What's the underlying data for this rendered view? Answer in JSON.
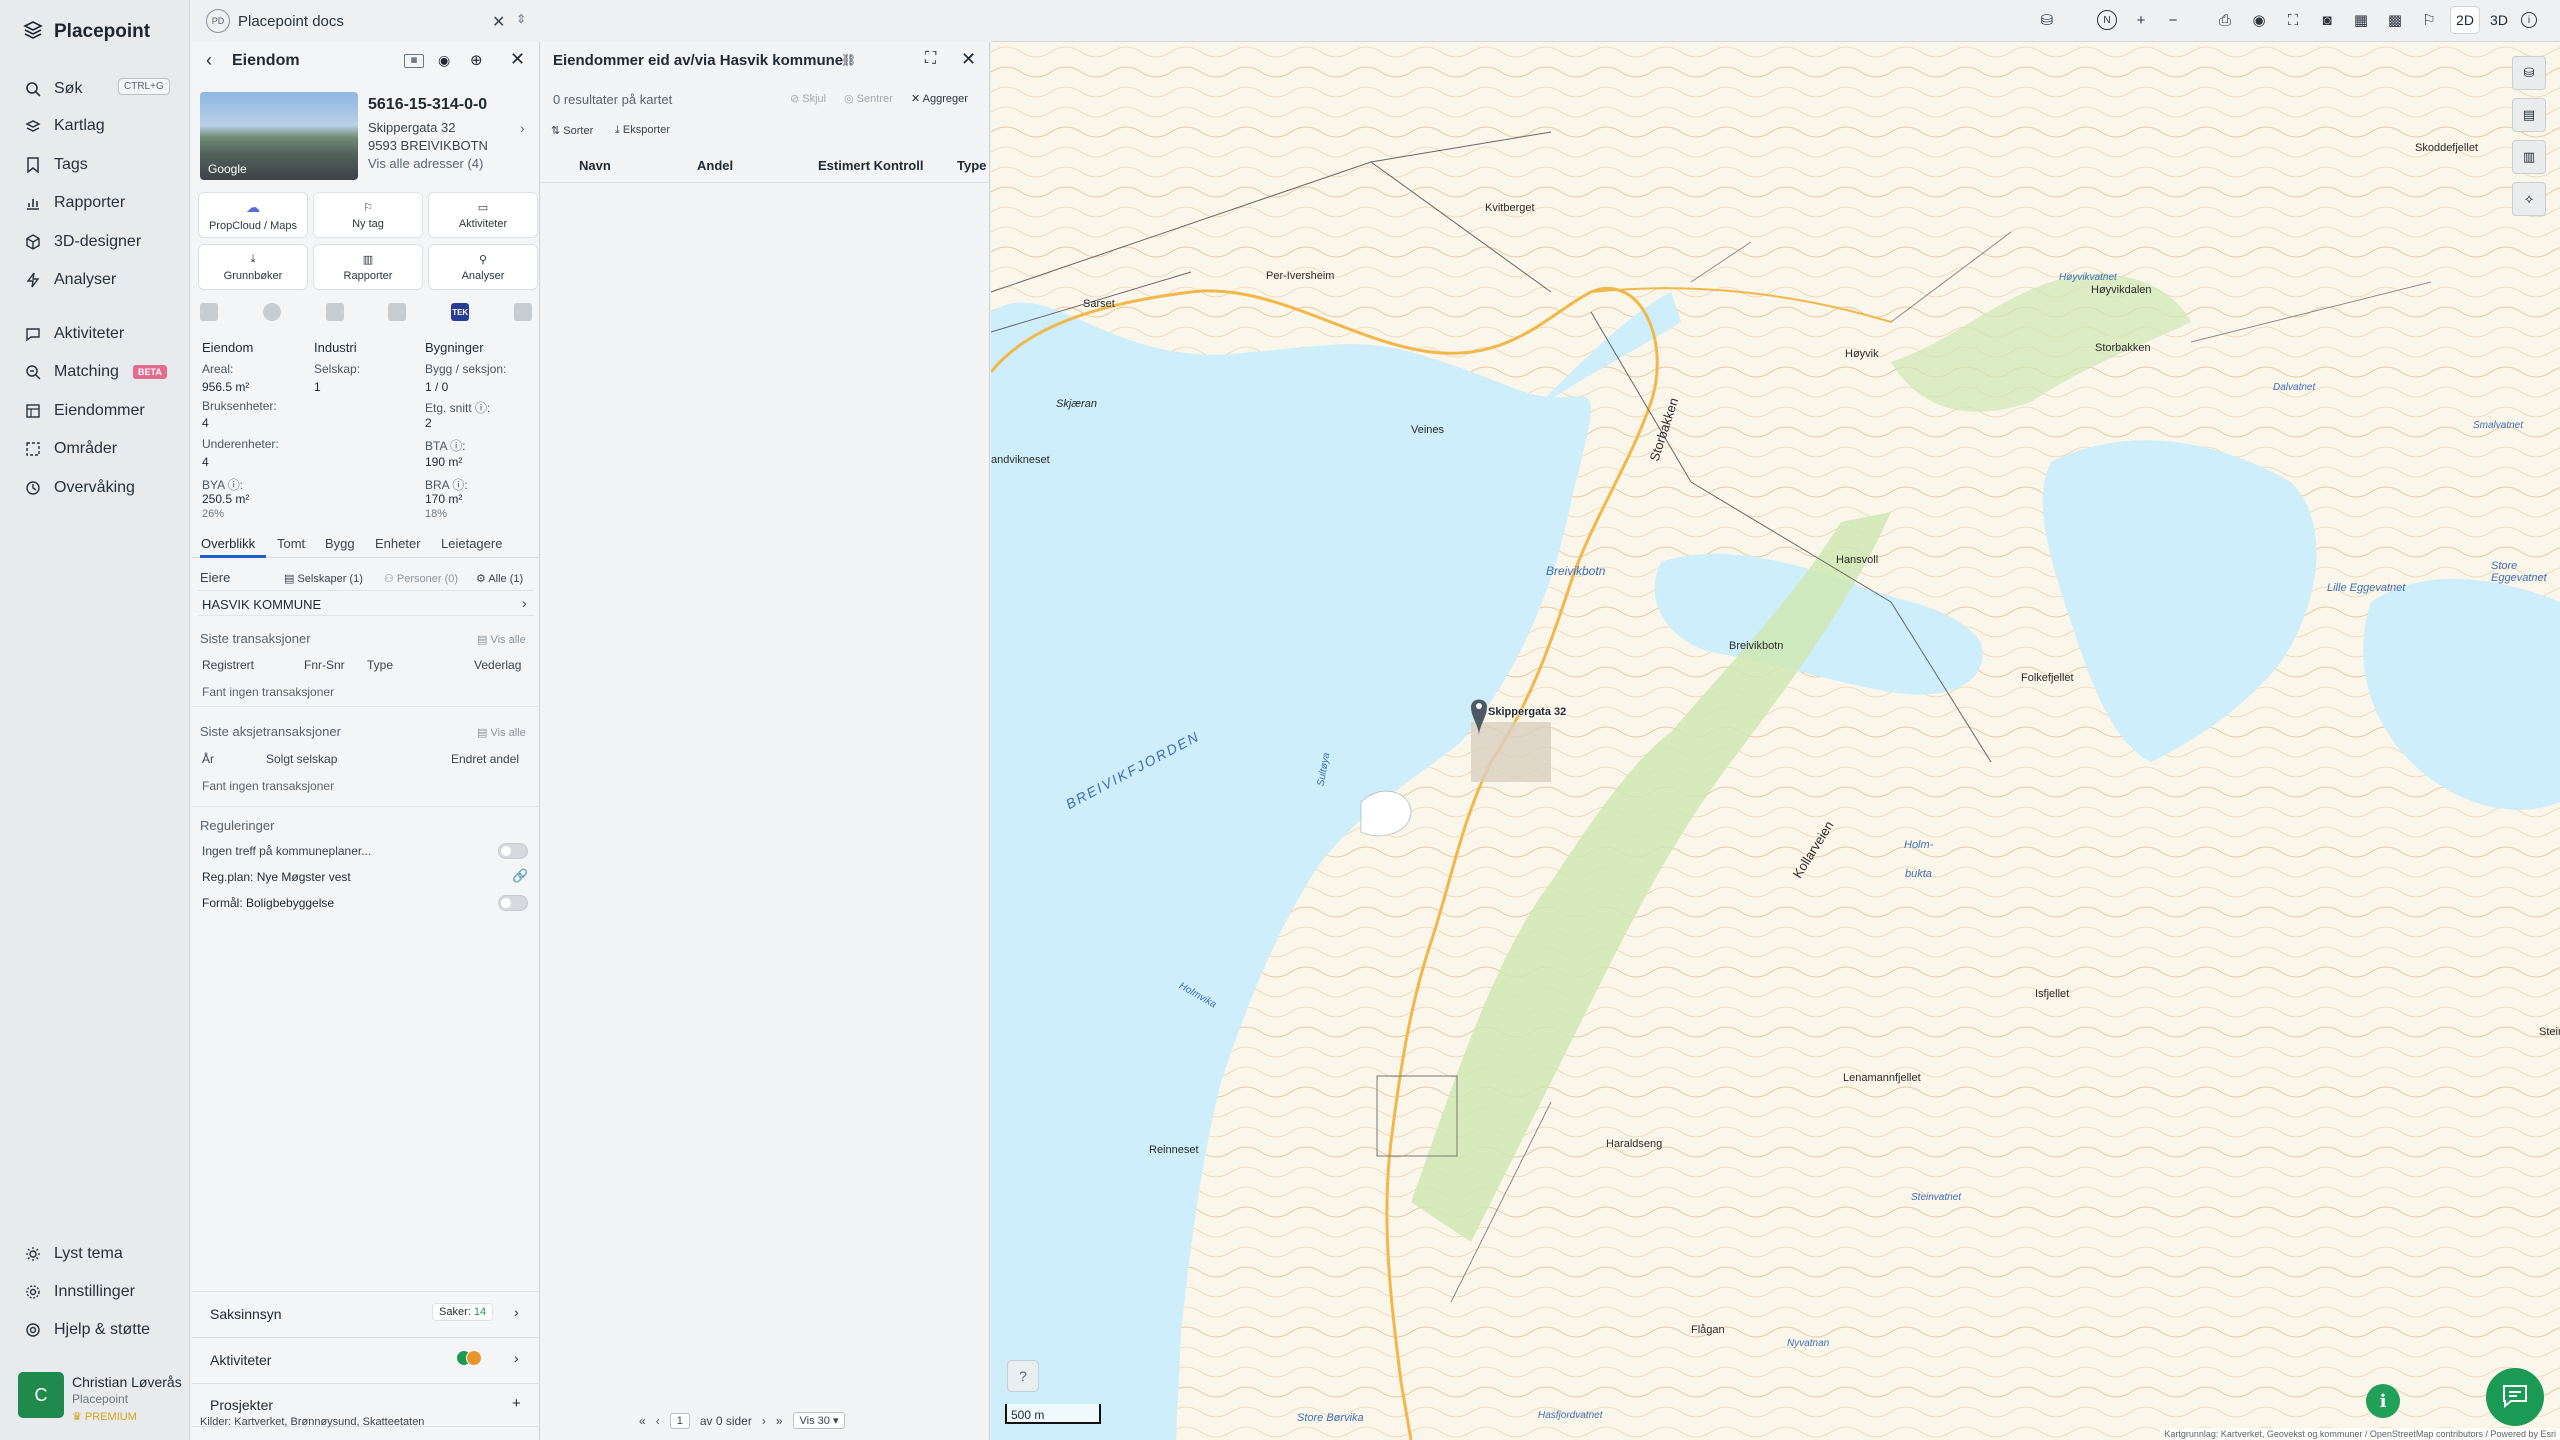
{
  "app": {
    "brand": "Placepoint"
  },
  "nav": {
    "items": [
      {
        "label": "Søk",
        "icon": "search-icon"
      },
      {
        "label": "Kartlag",
        "icon": "layers-icon"
      },
      {
        "label": "Tags",
        "icon": "bookmark-icon"
      },
      {
        "label": "Rapporter",
        "icon": "chart-icon"
      },
      {
        "label": "3D-designer",
        "icon": "cube-icon"
      },
      {
        "label": "Analyser",
        "icon": "bolt-icon"
      },
      {
        "label": "Aktiviteter",
        "icon": "chat-icon"
      },
      {
        "label": "Matching",
        "icon": "match-icon"
      },
      {
        "label": "Eiendommer",
        "icon": "building-icon"
      },
      {
        "label": "Områder",
        "icon": "area-icon"
      },
      {
        "label": "Overvåking",
        "icon": "eye-icon"
      }
    ],
    "search_shortcut": "CTRL+G",
    "matching_badge": "BETA",
    "bottom": [
      {
        "label": "Lyst tema",
        "icon": "sun-icon"
      },
      {
        "label": "Innstillinger",
        "icon": "gear-icon"
      },
      {
        "label": "Hjelp & støtte",
        "icon": "help-icon"
      }
    ],
    "user": {
      "initial": "C",
      "name": "Christian Løverås",
      "org": "Placepoint",
      "plan": "PREMIUM"
    }
  },
  "search_tab": {
    "badge": "PD",
    "text": "Placepoint docs"
  },
  "property": {
    "header_title": "Eiendom",
    "photo_credit": "Google",
    "id": "5616-15-314-0-0",
    "address": "Skippergata 32",
    "postal": "9593 BREIVIKBOTN",
    "all_addresses": "Vis alle adresser (4)",
    "actions": [
      {
        "label": "PropCloud / Maps"
      },
      {
        "label": "Ny tag"
      },
      {
        "label": "Aktiviteter"
      },
      {
        "label": "Grunnbøker"
      },
      {
        "label": "Rapporter"
      },
      {
        "label": "Analyser"
      }
    ],
    "tek_label": "TEK",
    "stats": {
      "col1_head": "Eiendom",
      "col2_head": "Industri",
      "col3_head": "Bygninger",
      "areal_label": "Areal:",
      "areal_value": "956.5 m²",
      "bruksenheter_label": "Bruksenheter:",
      "bruksenheter_value": "4",
      "underenheter_label": "Underenheter:",
      "underenheter_value": "4",
      "bya_label": "BYA ⓘ:",
      "bya_value": "250.5 m²",
      "bya_pct": "26%",
      "selskap_label": "Selskap:",
      "selskap_value": "1",
      "bygg_label": "Bygg / seksjon:",
      "bygg_value": "1 / 0",
      "etg_label": "Etg. snitt ⓘ:",
      "etg_value": "2",
      "bta_label": "BTA ⓘ:",
      "bta_value": "190 m²",
      "bra_label": "BRA ⓘ:",
      "bra_value": "170 m²",
      "bra_pct": "18%"
    },
    "tabs": [
      "Overblikk",
      "Tomt",
      "Bygg",
      "Enheter",
      "Leietagere"
    ],
    "owners": {
      "label": "Eiere",
      "filter_companies": "Selskaper (1)",
      "filter_persons": "Personer (0)",
      "filter_all": "Alle (1)",
      "owner": "HASVIK KOMMUNE"
    },
    "transactions": {
      "title": "Siste transaksjoner",
      "show_all": "Vis alle",
      "cols": [
        "Registrert",
        "Fnr-Snr",
        "Type",
        "Vederlag"
      ],
      "empty": "Fant ingen transaksjoner"
    },
    "share_transactions": {
      "title": "Siste aksjetransaksjoner",
      "show_all": "Vis alle",
      "cols": [
        "År",
        "Solgt selskap",
        "Endret andel"
      ],
      "empty": "Fant ingen transaksjoner"
    },
    "regulations": {
      "title": "Reguleringer",
      "items": [
        "Ingen treff på kommuneplaner...",
        "Reg.plan: Nye Møgster vest",
        "Formål: Boligbebyggelse"
      ]
    },
    "saksinnsyn": {
      "label": "Saksinnsyn",
      "count_label": "Saker:",
      "count": "14"
    },
    "aktiviteter": {
      "label": "Aktiviteter"
    },
    "prosjekter": {
      "label": "Prosjekter"
    },
    "sources": {
      "label": "Kilder:",
      "items": [
        "Kartverket,",
        "Brønnøysund,",
        "Skatteetaten"
      ]
    }
  },
  "results": {
    "title": "Eiendommer eid av/via Hasvik kommune",
    "count": "0 resultater på kartet",
    "hide": "Skjul",
    "center": "Sentrer",
    "aggregate": "Aggreger",
    "sort": "Sorter",
    "export": "Eksporter",
    "columns": [
      "Navn",
      "Andel",
      "Estimert Kontroll",
      "Type"
    ],
    "pager": {
      "page": "1",
      "of_pages": "av 0 sider",
      "per_page": "Vis 30"
    }
  },
  "map": {
    "mode_2d": "2D",
    "mode_3d": "3D",
    "scale": "500 m",
    "attribution": "Kartgrunnlag: Kartverket, Geovekst og kommuner / OpenStreetMap contributors / Powered by Esri",
    "pin_label": "Skippergata 32",
    "place_labels": [
      "Kvitberget",
      "Per-Iversheim",
      "Sarset",
      "Skjæran",
      "Høyvik",
      "Storbakken",
      "Veines",
      "Hansvoll",
      "Breivikbotn",
      "Folkefjellet",
      "Kollarveien",
      "Holm-",
      "bukta",
      "Isfjellet",
      "Lenamannfjellet",
      "Haraldseng",
      "Reinneset",
      "Flågan",
      "Skoddefjellet",
      "Høyvikdalen",
      "Storbakken",
      "Steinfjellet",
      "andvikneset",
      "Store Børvika",
      "Hasfjordvatnet",
      "Nyvatnan",
      "Steinvatnet",
      "Holmvika",
      "Sultøya"
    ],
    "water_labels": [
      "Breivikbotn",
      "BREIVIKFJORDEN",
      "Lille Eggevatnet",
      "Store Eggevatnet",
      "Høyvikvatnet",
      "Smalvatnet",
      "Dalvatnet"
    ]
  }
}
